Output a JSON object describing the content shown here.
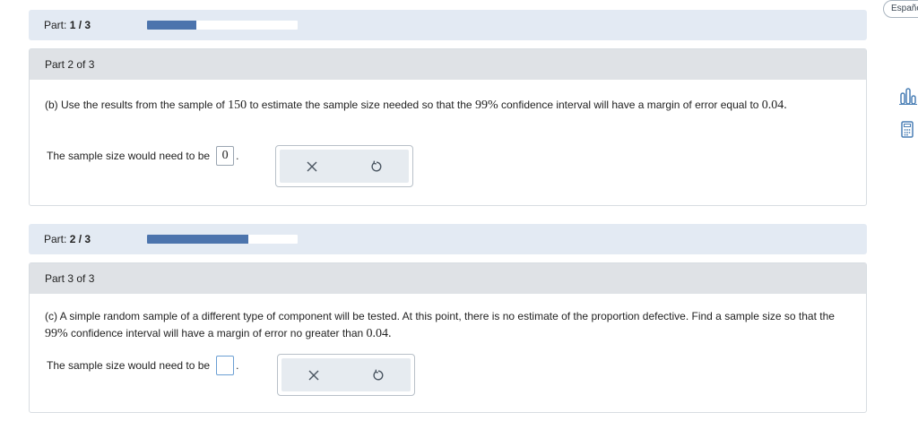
{
  "language_button": "Españo",
  "parts": [
    {
      "bar_prefix": "Part:",
      "bar_progress_text": "1 / 3",
      "progress_fraction": 0.33,
      "card_title": "Part 2 of 3",
      "question_label": "(b)",
      "question_text_1": "Use the results from the sample of",
      "value_n": "150",
      "question_text_2": "to estimate the sample size needed so that the",
      "value_conf": "99%",
      "question_text_3": "confidence interval will have a margin of error equal to",
      "value_moe": "0.04",
      "question_end": ".",
      "answer_prefix": "The sample size would need to be",
      "answer_value": "0",
      "answer_suffix": "."
    },
    {
      "bar_prefix": "Part:",
      "bar_progress_text": "2 / 3",
      "progress_fraction": 0.67,
      "card_title": "Part 3 of 3",
      "question_label": "(c)",
      "question_text_1": "A simple random sample of a different type of component will be tested. At this point, there is no estimate of the proportion defective. Find a sample size so that the",
      "value_conf": "99%",
      "question_text_2": "confidence interval will have a margin of error no greater than",
      "value_moe": "0.04",
      "question_end": ".",
      "answer_prefix": "The sample size would need to be",
      "answer_value": "",
      "answer_suffix": "."
    }
  ],
  "tools": {
    "clear_icon": "x-icon",
    "reset_icon": "undo-icon"
  },
  "side_icons": [
    "bar-chart-icon",
    "calculator-icon"
  ],
  "colors": {
    "accent": "#4c74ad",
    "part_bar_bg": "#e3eaf3",
    "card_header_bg": "#dfe2e6"
  }
}
